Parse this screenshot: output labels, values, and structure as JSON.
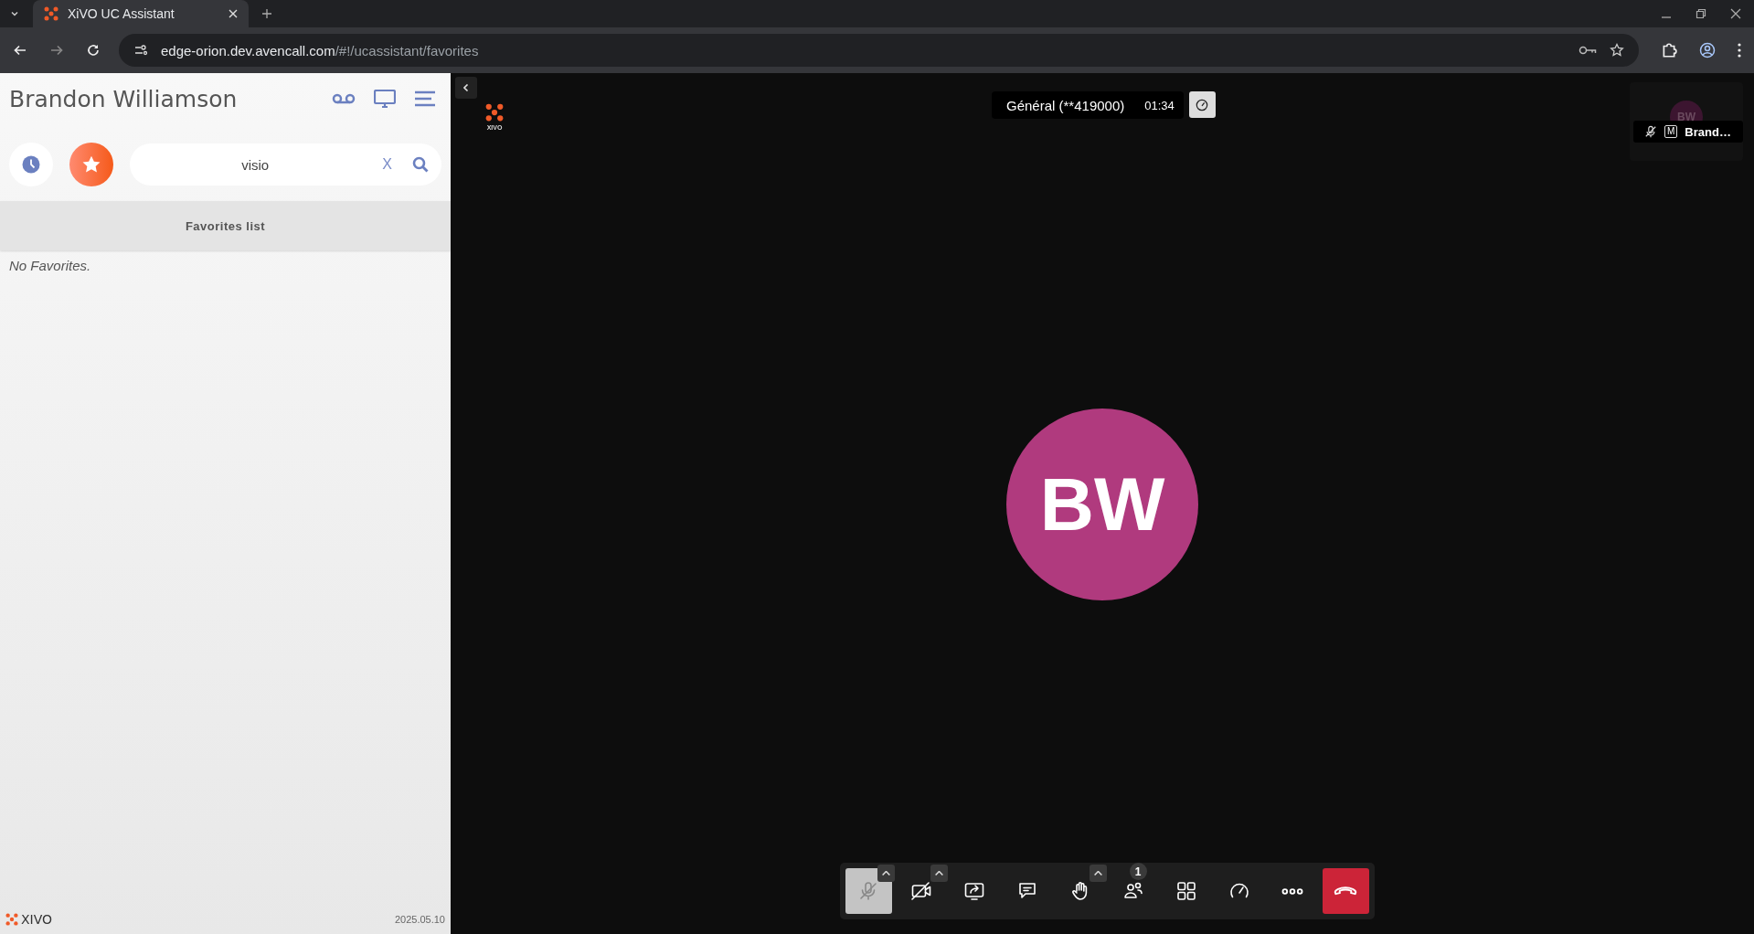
{
  "browser": {
    "tab": {
      "title": "XiVO UC Assistant"
    },
    "url": {
      "host": "edge-orion.dev.avencall.com",
      "path": "/#!/ucassistant/favorites"
    }
  },
  "assistant": {
    "user_name": "Brandon Williamson",
    "modes": [
      {
        "kind": "history",
        "selected": false
      },
      {
        "kind": "favorites",
        "selected": true
      }
    ],
    "search": {
      "value": "visio",
      "clear_label": "X"
    },
    "list_title": "Favorites list",
    "empty_text": "No Favorites.",
    "footer": {
      "brand": "XIVO",
      "version": "2025.05.10"
    }
  },
  "meeting": {
    "logo_text": "XIVO",
    "room": "Général (**419000)",
    "duration": "01:34",
    "avatar_initials": "BW",
    "thumbnail": {
      "initials": "BW",
      "role": "M",
      "name": "Brand…",
      "mic_muted": true
    },
    "toolbar": [
      {
        "kind": "mic",
        "active": true,
        "has_menu": true
      },
      {
        "kind": "camera",
        "active": false,
        "has_menu": true
      },
      {
        "kind": "share",
        "active": false,
        "has_menu": false
      },
      {
        "kind": "chat",
        "active": false,
        "has_menu": false
      },
      {
        "kind": "hand",
        "active": false,
        "has_menu": true
      },
      {
        "kind": "participants",
        "active": false,
        "has_menu": false,
        "badge": "1"
      },
      {
        "kind": "tiles",
        "active": false,
        "has_menu": false
      },
      {
        "kind": "stats",
        "active": false,
        "has_menu": false
      },
      {
        "kind": "more",
        "active": false,
        "has_menu": false
      },
      {
        "kind": "hangup",
        "active": false,
        "has_menu": false
      }
    ]
  }
}
